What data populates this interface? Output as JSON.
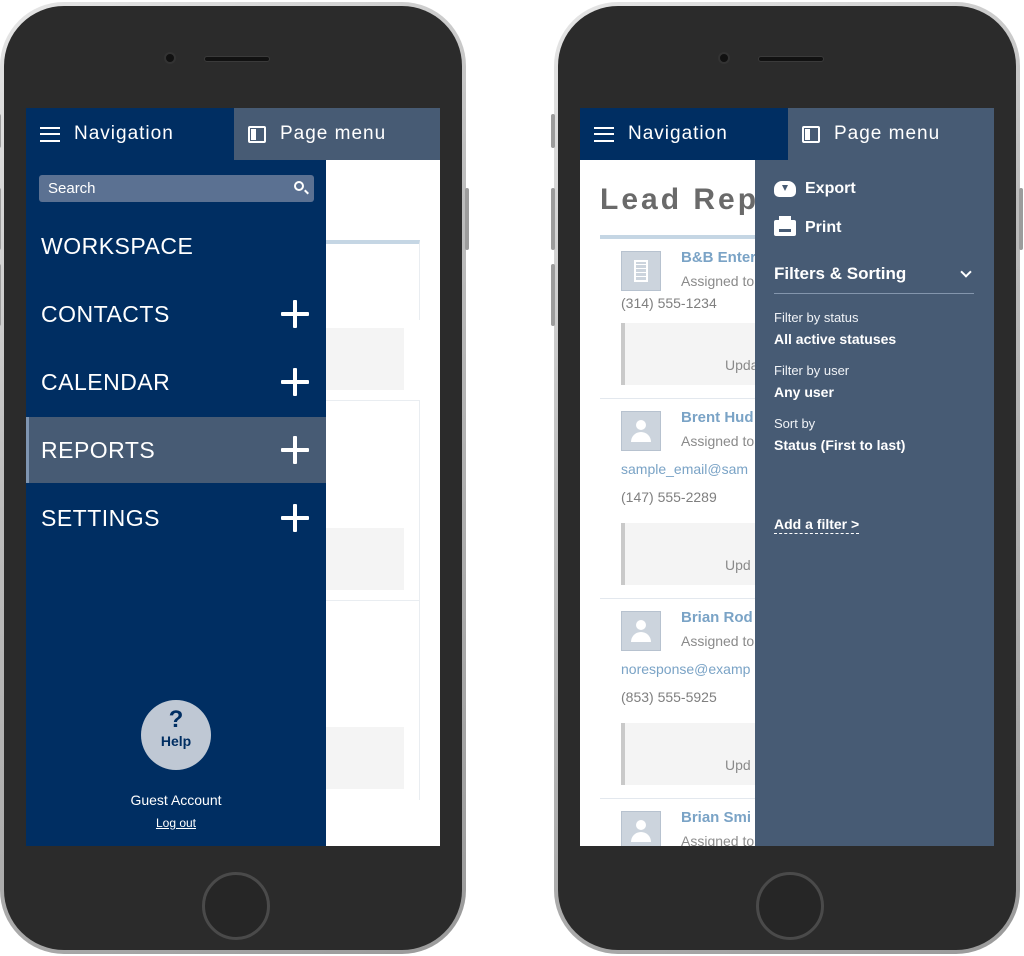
{
  "colors": {
    "nav_bg": "#002e62",
    "panel_bg": "#475b74",
    "link": "#7aa3c6"
  },
  "topbar": {
    "navigation_label": "Navigation",
    "page_menu_label": "Page menu"
  },
  "phone1": {
    "search": {
      "label": "Search"
    },
    "nav_items": [
      {
        "label": "WORKSPACE",
        "expandable": false
      },
      {
        "label": "CONTACTS",
        "expandable": true
      },
      {
        "label": "CALENDAR",
        "expandable": true
      },
      {
        "label": "REPORTS",
        "expandable": true,
        "active": true
      },
      {
        "label": "SETTINGS",
        "expandable": true
      }
    ],
    "help": {
      "glyph": "?",
      "label": "Help"
    },
    "account": {
      "name": "Guest Account",
      "logout": "Log out"
    }
  },
  "phone2": {
    "page_title": "Lead Repo",
    "leads": [
      {
        "name": "B&B Enter",
        "assigned": "Assigned to",
        "phone": "(314) 555-1234",
        "update": "Upda",
        "icon": "building-icon"
      },
      {
        "name": "Brent Hud",
        "assigned": "Assigned to",
        "email": "sample_email@sam",
        "phone": "(147) 555-2289",
        "update": "Upd",
        "icon": "person-icon"
      },
      {
        "name": "Brian Rod",
        "assigned": "Assigned to",
        "email": "noresponse@examp",
        "phone": "(853) 555-5925",
        "update": "Upd",
        "icon": "person-icon"
      },
      {
        "name": "Brian Smi",
        "assigned": "Assigned to",
        "icon": "person-icon"
      }
    ],
    "page_menu": {
      "export": "Export",
      "print": "Print",
      "filters_heading": "Filters & Sorting",
      "filters": [
        {
          "label": "Filter by status",
          "value": "All active statuses"
        },
        {
          "label": "Filter by user",
          "value": "Any user"
        },
        {
          "label": "Sort by",
          "value": "Status (First to last)"
        }
      ],
      "add_filter": "Add a filter >"
    }
  }
}
